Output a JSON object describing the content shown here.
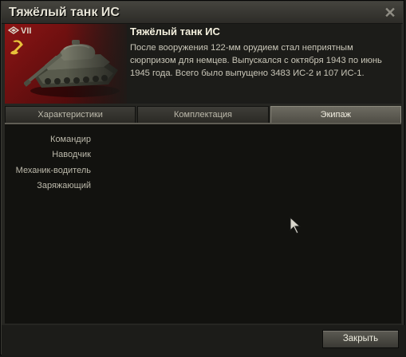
{
  "window": {
    "title": "Тяжёлый танк ИС",
    "close_icon": "close-icon"
  },
  "vehicle": {
    "tier": "VII",
    "class_icon": "heavy-tank-class-icon",
    "nation_icon": "ussr-flag-icon",
    "name": "Тяжёлый танк ИС",
    "description": "После вооружения 122-мм орудием стал неприятным сюрпризом для немцев. Выпускался с октября 1943 по июнь 1945 года. Всего было выпущено 3483 ИС-2 и 107 ИС-1."
  },
  "tabs": [
    {
      "label": "Характеристики",
      "active": false
    },
    {
      "label": "Комплектация",
      "active": false
    },
    {
      "label": "Экипаж",
      "active": true
    }
  ],
  "crew": [
    "Командир",
    "Наводчик",
    "Механик-водитель",
    "Заряжающий"
  ],
  "footer": {
    "close_label": "Закрыть"
  },
  "colors": {
    "flag_red": "#8c1414",
    "active_tab": "#6d6b61",
    "window_bg": "#262622",
    "content_bg": "#12120f"
  }
}
